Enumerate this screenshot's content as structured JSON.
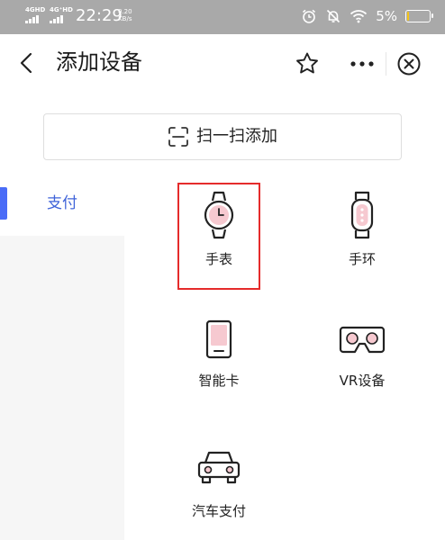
{
  "status_bar": {
    "network_1": "4GHD",
    "network_2": "4G⁺HD",
    "time": "22:29",
    "speed_value": "0.20",
    "speed_unit": "KB/s",
    "battery_percent": "5%",
    "battery_level": 0.05,
    "icons": [
      "alarm-icon",
      "mute-bell-icon",
      "wifi-icon",
      "battery-icon"
    ]
  },
  "header": {
    "title": "添加设备",
    "icons": [
      "back-icon",
      "star-icon",
      "more-icon",
      "close-icon"
    ]
  },
  "scan": {
    "label": "扫一扫添加",
    "icon": "scan-icon"
  },
  "categories": [
    {
      "label": "支付",
      "selected": true
    }
  ],
  "devices": [
    {
      "label": "手表",
      "icon": "watch-icon",
      "highlighted": true
    },
    {
      "label": "手环",
      "icon": "band-icon",
      "highlighted": false
    },
    {
      "label": "智能卡",
      "icon": "card-icon",
      "highlighted": false
    },
    {
      "label": "VR设备",
      "icon": "vr-icon",
      "highlighted": false
    },
    {
      "label": "汽车支付",
      "icon": "car-icon",
      "highlighted": false
    }
  ],
  "colors": {
    "status_bar_bg": "#a9a9a9",
    "accent_blue": "#3f63d9",
    "indicator_blue": "#4a6cf7",
    "highlight_red": "#e52b2b",
    "icon_pink": "#f6c9d0",
    "battery_fill": "#f5c518"
  }
}
